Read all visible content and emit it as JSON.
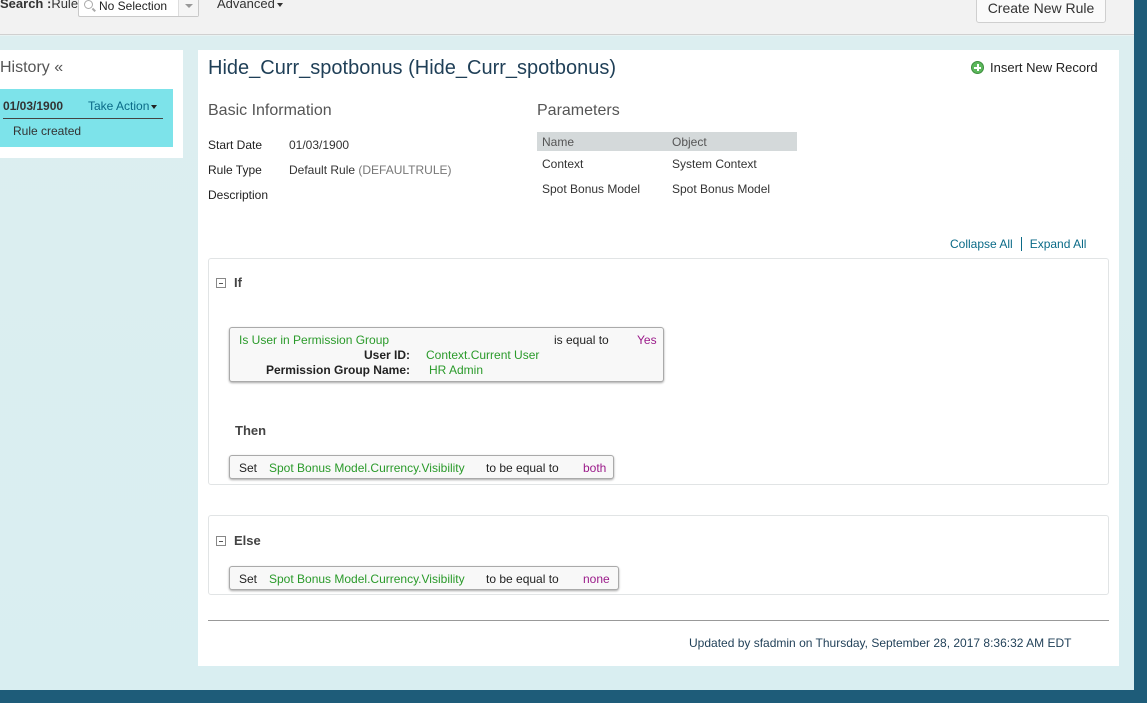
{
  "toolbar": {
    "search_label": "Search :",
    "search_type": "Rule",
    "selector_value": "No Selection",
    "advanced_label": "Advanced",
    "create_button": "Create New Rule"
  },
  "history": {
    "title": "History «",
    "entry": {
      "date": "01/03/1900",
      "action": "Take Action",
      "note": "Rule created"
    }
  },
  "rule": {
    "title": "Hide_Curr_spotbonus (Hide_Curr_spotbonus)",
    "insert_label": "Insert New Record",
    "basic": {
      "heading": "Basic Information",
      "start_date_label": "Start Date",
      "start_date": "01/03/1900",
      "rule_type_label": "Rule Type",
      "rule_type": "Default Rule",
      "rule_type_code": "(DEFAULTRULE)",
      "description_label": "Description"
    },
    "parameters": {
      "heading": "Parameters",
      "columns": [
        "Name",
        "Object"
      ],
      "rows": [
        [
          "Context",
          "System Context"
        ],
        [
          "Spot Bonus Model",
          "Spot Bonus Model"
        ]
      ]
    },
    "collapse_all": "Collapse All",
    "expand_all": "Expand All",
    "if_block": {
      "label": "If",
      "condition": {
        "function": "Is User in Permission Group",
        "operator": "is equal to",
        "value": "Yes",
        "param1_label": "User ID:",
        "param1_value": "Context.Current User",
        "param2_label": "Permission Group Name:",
        "param2_value": "HR Admin"
      },
      "then_label": "Then",
      "action": {
        "verb": "Set",
        "field": "Spot Bonus Model.Currency.Visibility",
        "op": "to be equal to",
        "value": "both"
      }
    },
    "else_block": {
      "label": "Else",
      "action": {
        "verb": "Set",
        "field": "Spot Bonus Model.Currency.Visibility",
        "op": "to be equal to",
        "value": "none"
      }
    },
    "updated": "Updated by sfadmin on Thursday, September 28, 2017 8:36:32 AM EDT"
  }
}
